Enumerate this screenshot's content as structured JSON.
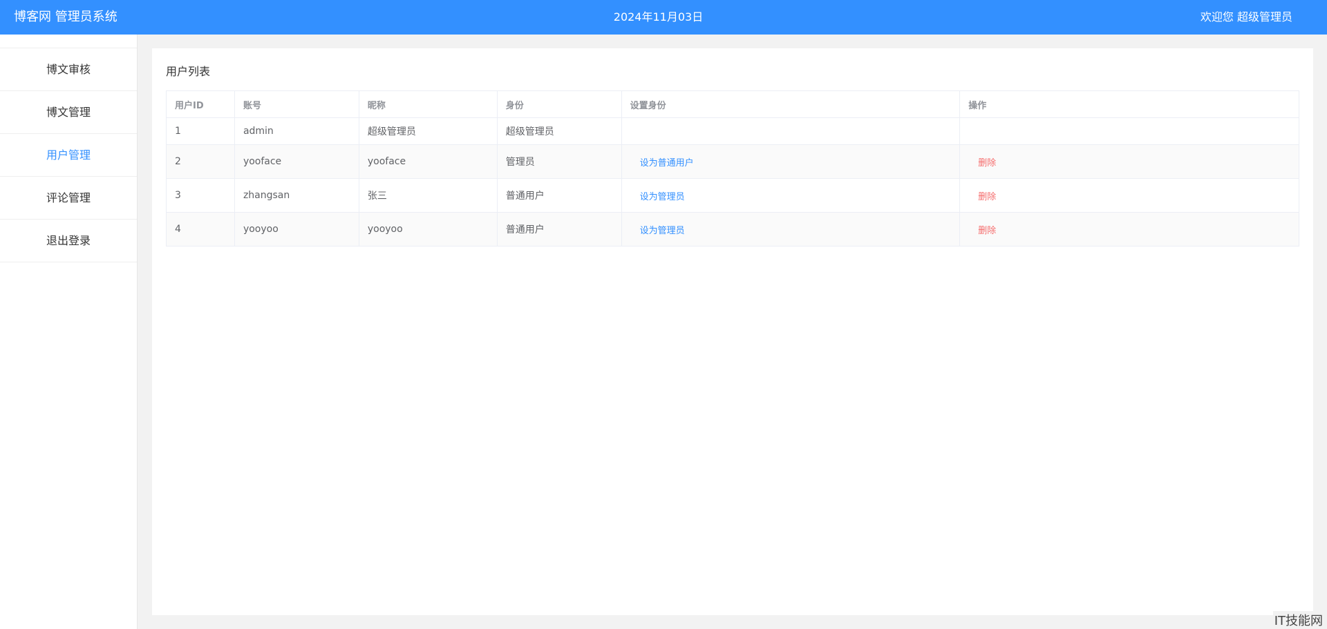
{
  "header": {
    "app_title": "博客网 管理员系统",
    "date": "2024年11月03日",
    "welcome": "欢迎您 超级管理员"
  },
  "sidebar": {
    "items": [
      {
        "label": "博文审核",
        "active": false
      },
      {
        "label": "博文管理",
        "active": false
      },
      {
        "label": "用户管理",
        "active": true
      },
      {
        "label": "评论管理",
        "active": false
      },
      {
        "label": "退出登录",
        "active": false
      }
    ]
  },
  "main": {
    "title": "用户列表",
    "columns": [
      "用户ID",
      "账号",
      "昵称",
      "身份",
      "设置身份",
      "操作"
    ],
    "rows": [
      {
        "id": "1",
        "account": "admin",
        "nickname": "超级管理员",
        "role": "超级管理员",
        "set_role": "",
        "action": ""
      },
      {
        "id": "2",
        "account": "yooface",
        "nickname": "yooface",
        "role": "管理员",
        "set_role": "设为普通用户",
        "action": "删除"
      },
      {
        "id": "3",
        "account": "zhangsan",
        "nickname": "张三",
        "role": "普通用户",
        "set_role": "设为管理员",
        "action": "删除"
      },
      {
        "id": "4",
        "account": "yooyoo",
        "nickname": "yooyoo",
        "role": "普通用户",
        "set_role": "设为管理员",
        "action": "删除"
      }
    ]
  },
  "watermark": "IT技能网",
  "colors": {
    "accent": "#3390ff",
    "danger": "#f56c6c"
  }
}
